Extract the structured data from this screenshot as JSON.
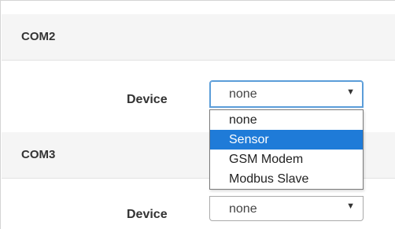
{
  "sections": [
    {
      "title": "COM2",
      "device_label": "Device",
      "selected_value": "none",
      "open": true
    },
    {
      "title": "COM3",
      "device_label": "Device",
      "selected_value": "none",
      "open": false
    }
  ],
  "dropdown": {
    "options": [
      "none",
      "Sensor",
      "GSM Modem",
      "Modbus Slave"
    ],
    "highlighted_index": 1
  },
  "icons": {
    "select_arrow": "▼"
  },
  "colors": {
    "highlight": "#1f7bd8",
    "focus_border": "#5b9dd9",
    "header_bg": "#f5f5f5"
  }
}
